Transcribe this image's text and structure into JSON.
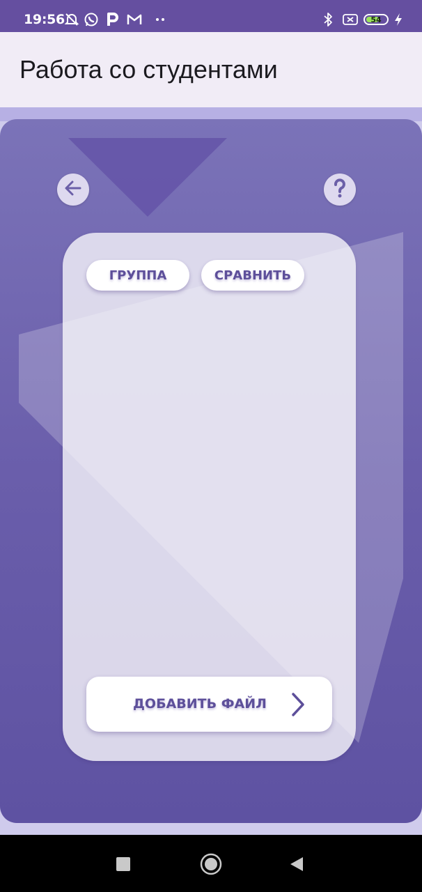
{
  "status_bar": {
    "time": "19:56",
    "battery_level": "54",
    "left_icons": [
      "alarm-off-icon",
      "whatsapp-icon",
      "p-app-icon",
      "gmail-icon",
      "more-dots-icon"
    ],
    "right_icons": [
      "bluetooth-icon",
      "no-sim-icon",
      "battery-icon",
      "charging-icon"
    ]
  },
  "app_bar": {
    "title": "Работа со студентами"
  },
  "toolbar": {
    "back_icon": "arrow-left-icon",
    "help_icon": "question-mark-icon"
  },
  "tabs": [
    {
      "label": "ГРУППА"
    },
    {
      "label": "СРАВНИТЬ"
    }
  ],
  "actions": {
    "add_file_label": "ДОБАВИТЬ ФАЙЛ",
    "add_file_icon": "chevron-right-icon"
  },
  "navigation": {
    "icons": [
      "recents-square-icon",
      "home-circle-icon",
      "back-triangle-icon"
    ]
  },
  "colors": {
    "status_bar": "#654fa0",
    "app_bar": "#f1ecf6",
    "panel_top": "#7b73b8",
    "panel_bottom": "#5e52a2",
    "accent_text": "#5d4f9a",
    "battery_fill": "#9ae35a"
  }
}
